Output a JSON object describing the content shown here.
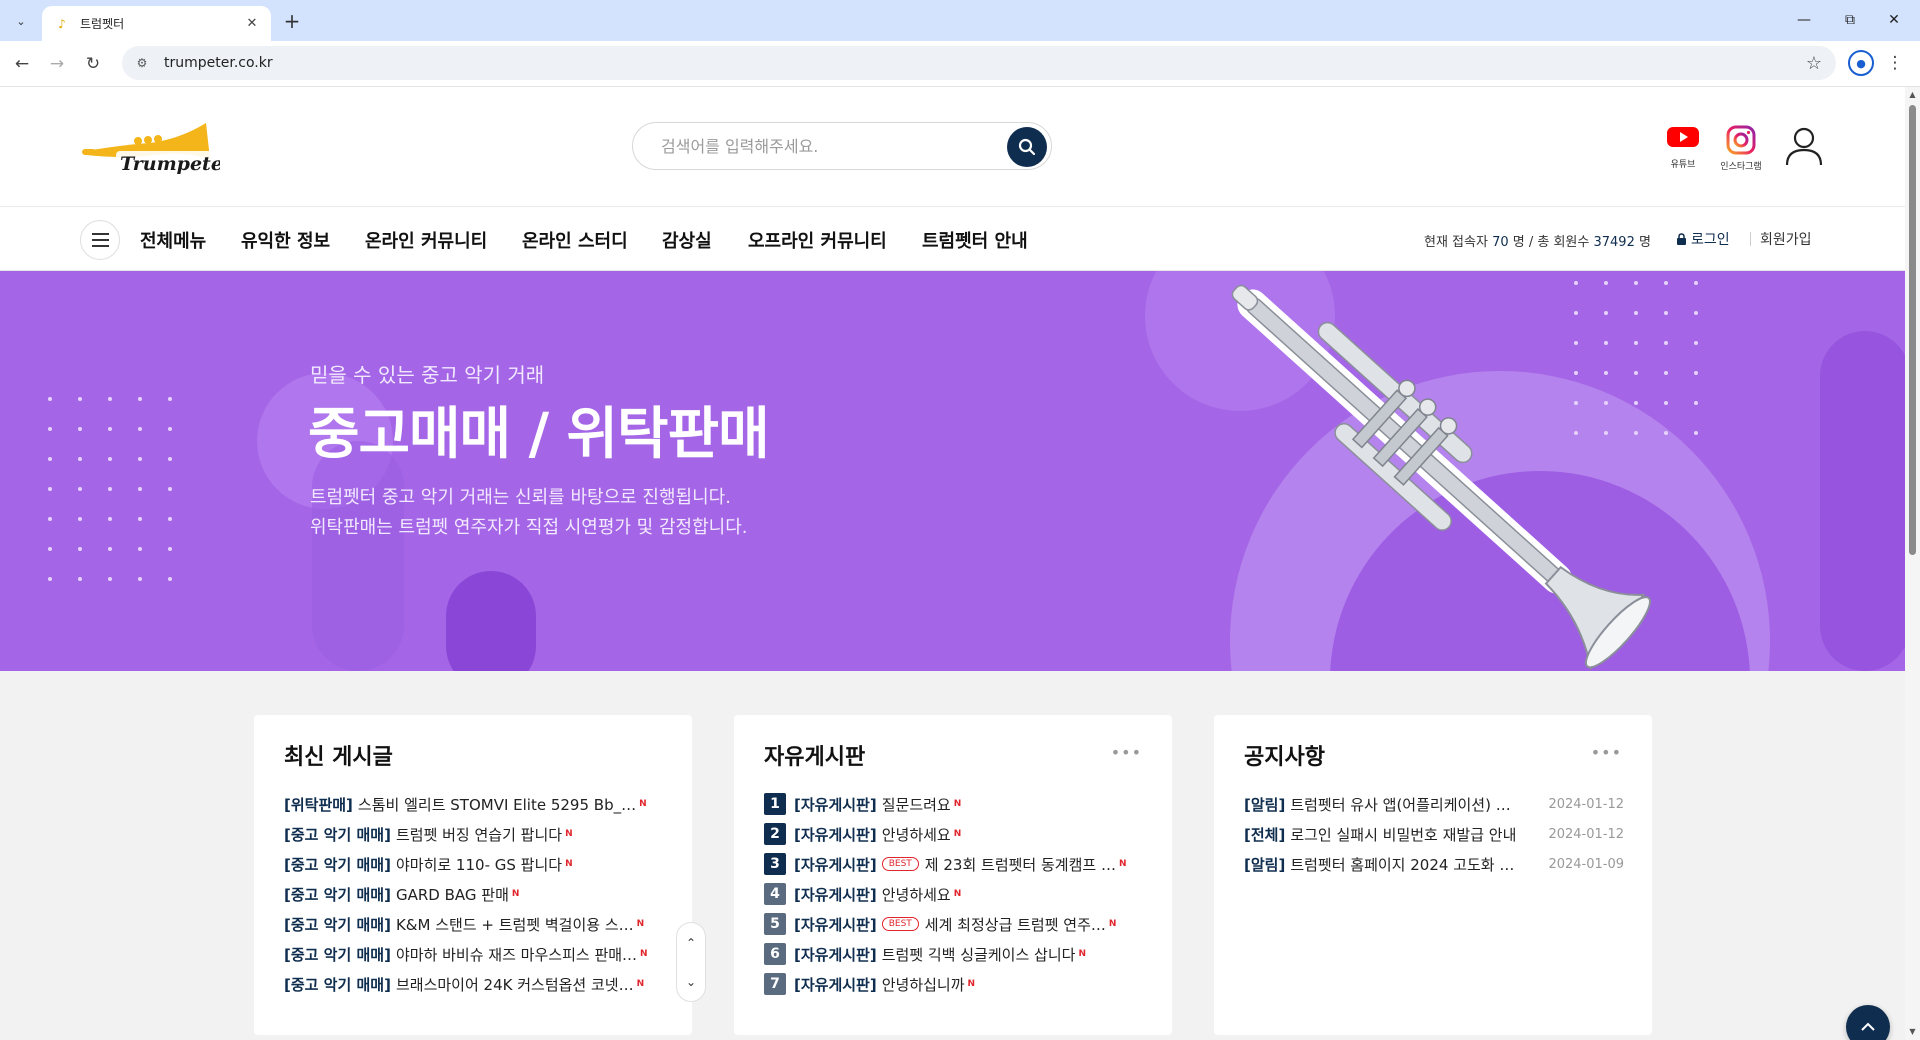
{
  "browser": {
    "tab_title": "트럼펫터",
    "url": "trumpeter.co.kr"
  },
  "header": {
    "logo_text": "Trumpeter",
    "search_placeholder": "검색어를 입력해주세요.",
    "youtube_label": "유튜브",
    "instagram_label": "인스타그램"
  },
  "nav": {
    "items": [
      "전체메뉴",
      "유익한 정보",
      "온라인 커뮤니티",
      "온라인 스터디",
      "감상실",
      "오프라인 커뮤니티",
      "트럼펫터 안내"
    ],
    "stats_current_label": "현재 접속자",
    "stats_current": "70",
    "stats_total_label": "명 / 총 회원수",
    "stats_total": "37492",
    "stats_unit": "명",
    "login": "로그인",
    "signup": "회원가입"
  },
  "hero": {
    "subtitle": "믿을 수 있는 중고 악기 거래",
    "title": "중고매매 / 위탁판매",
    "desc1": "트럼펫터 중고 악기 거래는 신뢰를 바탕으로 진행됩니다.",
    "desc2": "위탁판매는 트럼펫 연주자가 직접 시연평가 및 감정합니다."
  },
  "latest": {
    "title": "최신 게시글",
    "posts": [
      {
        "cat": "[위탁판매]",
        "title": "스톰비 엘리트 STOMVI Elite 5295 Bb_…",
        "new": "N"
      },
      {
        "cat": "[중고 악기 매매]",
        "title": "트럼펫 버징 연습기 팝니다",
        "new": "N"
      },
      {
        "cat": "[중고 악기 매매]",
        "title": "야마히로 110- GS 팝니다",
        "new": "N"
      },
      {
        "cat": "[중고 악기 매매]",
        "title": "GARD BAG 판매",
        "new": "N"
      },
      {
        "cat": "[중고 악기 매매]",
        "title": "K&M 스탠드 + 트럼펫 벽걸이용 스…",
        "new": "N"
      },
      {
        "cat": "[중고 악기 매매]",
        "title": "야마하 바비슈 재즈 마우스피스 판매…",
        "new": "N"
      },
      {
        "cat": "[중고 악기 매매]",
        "title": "브래스마이어 24K 커스텀옵션 코넷…",
        "new": "N"
      }
    ]
  },
  "free": {
    "title": "자유게시판",
    "more": "•••",
    "posts": [
      {
        "rank": "1",
        "cat": "[자유게시판]",
        "best": "",
        "title": "질문드려요",
        "new": "N"
      },
      {
        "rank": "2",
        "cat": "[자유게시판]",
        "best": "",
        "title": "안녕하세요",
        "new": "N"
      },
      {
        "rank": "3",
        "cat": "[자유게시판]",
        "best": "BEST",
        "title": "제 23회 트럼펫터 동계캠프 …",
        "new": "N"
      },
      {
        "rank": "4",
        "cat": "[자유게시판]",
        "best": "",
        "title": "안녕하세요",
        "new": "N"
      },
      {
        "rank": "5",
        "cat": "[자유게시판]",
        "best": "BEST",
        "title": "세계 최정상급 트럼펫 연주…",
        "new": "N"
      },
      {
        "rank": "6",
        "cat": "[자유게시판]",
        "best": "",
        "title": "트럼펫 긱백 싱글케이스 삽니다",
        "new": "N"
      },
      {
        "rank": "7",
        "cat": "[자유게시판]",
        "best": "",
        "title": "안녕하십니까",
        "new": "N"
      }
    ]
  },
  "notice": {
    "title": "공지사항",
    "more": "•••",
    "posts": [
      {
        "cat": "[알림]",
        "title": "트럼펫터 유사 앱(어플리케이션) …",
        "date": "2024-01-12"
      },
      {
        "cat": "[전체]",
        "title": "로그인 실패시 비밀번호 재발급 안내",
        "date": "2024-01-12"
      },
      {
        "cat": "[알림]",
        "title": "트럼펫터 홈페이지 2024 고도화 …",
        "date": "2024-01-09"
      }
    ]
  },
  "colors": {
    "navy": "#0f2d4e",
    "hero_purple": "#a466e6",
    "new_red": "#e0262c"
  }
}
